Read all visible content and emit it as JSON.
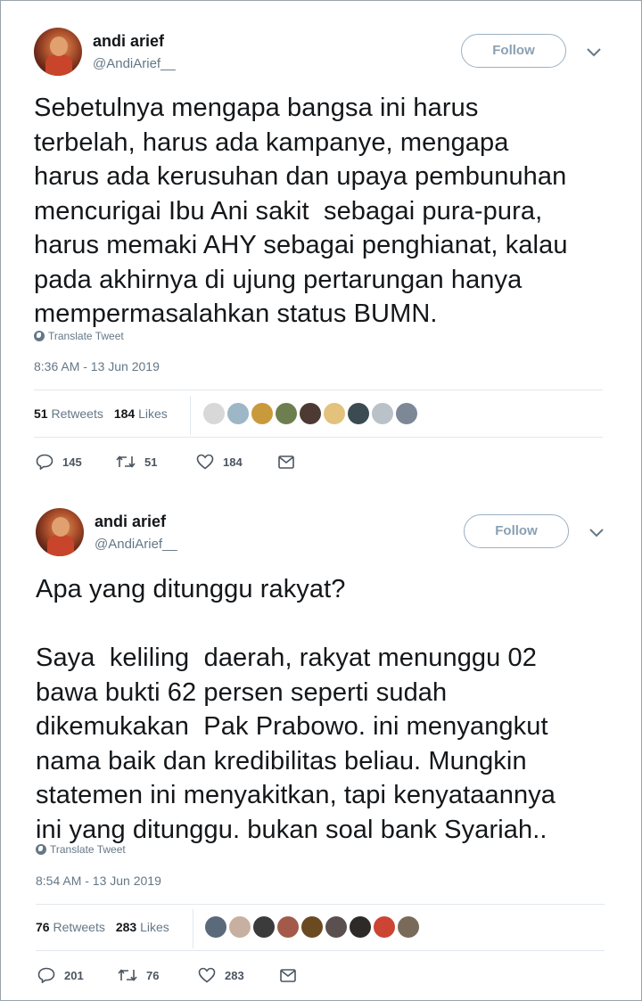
{
  "tweets": [
    {
      "author": {
        "name": "andi arief",
        "handle": "@AndiArief__"
      },
      "follow_label": "Follow",
      "text": "Sebetulnya mengapa bangsa ini harus\nterbelah, harus ada kampanye, mengapa\nharus ada kerusuhan dan upaya pembunuhan\nmencurigai Ibu Ani sakit  sebagai pura-pura,\nharus memaki AHY sebagai penghianat, kalau\npada akhirnya di ujung pertarungan hanya\nmempermasalahkan status BUMN.",
      "translate_label": "Translate Tweet",
      "timestamp": "8:36 AM - 13 Jun 2019",
      "retweets_count": "51",
      "retweets_label": "Retweets",
      "likes_count": "184",
      "likes_label": "Likes",
      "face_colors": [
        "#d8d8d8",
        "#9db7c6",
        "#c99a3c",
        "#6d7f4e",
        "#4d3a33",
        "#e2c27c",
        "#3c4a52",
        "#b9c2c8",
        "#7c8896"
      ],
      "actions": {
        "replies": "145",
        "retweets": "51",
        "likes": "184"
      }
    },
    {
      "author": {
        "name": "andi arief",
        "handle": "@AndiArief__"
      },
      "follow_label": "Follow",
      "text": "Apa yang ditunggu rakyat?\n\nSaya  keliling  daerah, rakyat menunggu 02\nbawa bukti 62 persen seperti sudah\ndikemukakan  Pak Prabowo. ini menyangkut\nnama baik dan kredibilitas beliau. Mungkin\nstatemen ini menyakitkan, tapi kenyataannya\nini yang ditunggu. bukan soal bank Syariah..",
      "translate_label": "Translate Tweet",
      "timestamp": "8:54 AM - 13 Jun 2019",
      "retweets_count": "76",
      "retweets_label": "Retweets",
      "likes_count": "283",
      "likes_label": "Likes",
      "face_colors": [
        "#5a6a7a",
        "#c8b0a0",
        "#3b3b3b",
        "#a45a4a",
        "#6b4a22",
        "#5b5050",
        "#2e2a28",
        "#cc4433",
        "#7a6a5a"
      ],
      "actions": {
        "replies": "201",
        "retweets": "76",
        "likes": "283"
      }
    }
  ]
}
